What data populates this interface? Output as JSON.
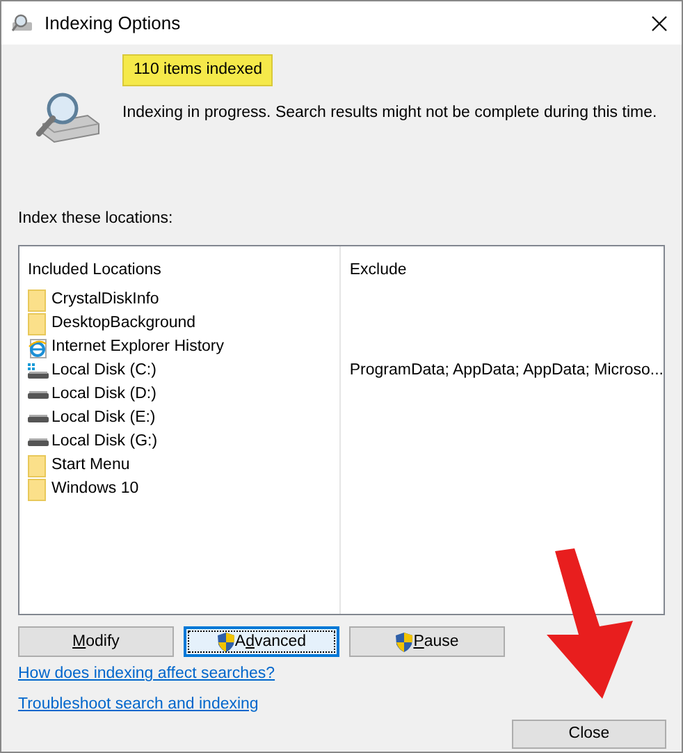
{
  "window": {
    "title": "Indexing Options"
  },
  "status": {
    "count": "110 items indexed",
    "message": "Indexing in progress. Search results might not be complete during this time."
  },
  "locations_label": "Index these locations:",
  "table": {
    "columns": [
      "Included Locations",
      "Exclude"
    ],
    "rows": [
      {
        "kind": "folder",
        "location": "CrystalDiskInfo"
      },
      {
        "kind": "folder",
        "location": "DesktopBackground"
      },
      {
        "kind": "browser",
        "location": "Internet Explorer History"
      },
      {
        "kind": "system-disk",
        "location": "Local Disk (C:)",
        "exclude": "ProgramData; AppData; AppData; Microso..."
      },
      {
        "kind": "disk",
        "location": "Local Disk (D:)"
      },
      {
        "kind": "disk",
        "location": "Local Disk (E:)"
      },
      {
        "kind": "disk",
        "location": "Local Disk (G:)"
      },
      {
        "kind": "folder",
        "location": "Start Menu"
      },
      {
        "kind": "folder",
        "location": "Windows 10"
      }
    ]
  },
  "buttons": [
    {
      "label_parts": [
        {
          "text": "M",
          "underlined": true
        },
        {
          "text": "odify",
          "underlined": false
        }
      ],
      "shield": false,
      "focused": false
    },
    {
      "label_parts": [
        {
          "text": "A",
          "underlined": false
        },
        {
          "text": "d",
          "underlined": true
        },
        {
          "text": "vanced",
          "underlined": false
        }
      ],
      "shield": true,
      "focused": true
    },
    {
      "label_parts": [
        {
          "text": "P",
          "underlined": true
        },
        {
          "text": "ause",
          "underlined": false
        }
      ],
      "shield": true,
      "focused": false
    }
  ],
  "links": [
    "How does indexing affect searches?",
    "Troubleshoot search and indexing"
  ],
  "close_button": "Close"
}
